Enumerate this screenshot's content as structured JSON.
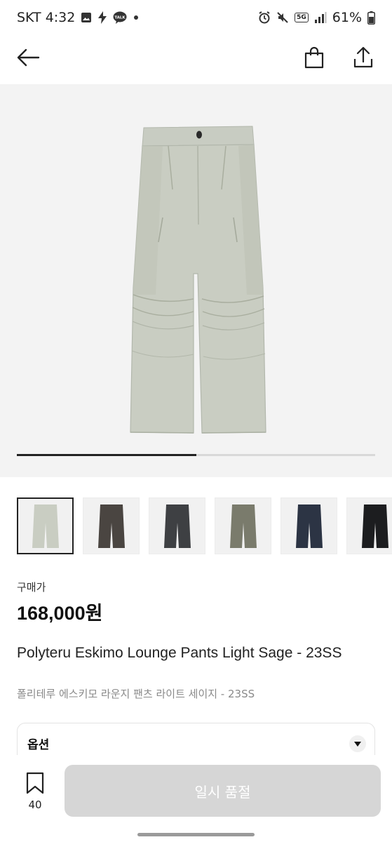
{
  "status_bar": {
    "carrier_time": "SKT 4:32",
    "notif_icons": [
      "image-icon",
      "bolt-icon",
      "kakaotalk-icon",
      "dot-icon"
    ],
    "network_badge": "5G",
    "battery": "61%"
  },
  "top_nav": {
    "back_icon": "arrow-left-icon",
    "cart_icon": "shopping-bag-icon",
    "share_icon": "share-icon"
  },
  "gallery": {
    "progress": 0.5,
    "thumbnail_colors": [
      "#c9cdc2",
      "#4a4541",
      "#3e4043",
      "#7a7b6c",
      "#2c3444",
      "#1c1d1f"
    ],
    "selected_index": 0
  },
  "price": {
    "label": "구매가",
    "value": "168,000원"
  },
  "product": {
    "title_en": "Polyteru Eskimo Lounge Pants Light Sage - 23SS",
    "title_ko": "폴리테루 에스키모 라운지 팬츠 라이트 세이지 - 23SS"
  },
  "option": {
    "label": "옵션"
  },
  "bottom_bar": {
    "bookmark_count": "40",
    "soldout_label": "일시 품절"
  }
}
